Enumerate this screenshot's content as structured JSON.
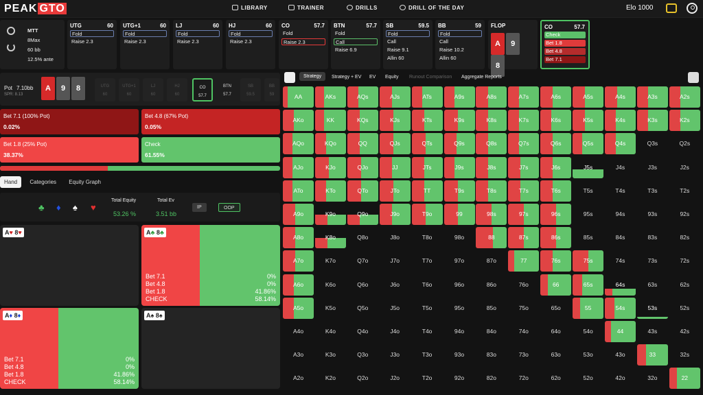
{
  "brand": {
    "logo_left": "PEAK",
    "logo_right": "GTO"
  },
  "nav": [
    {
      "label": "LIBRARY",
      "icon": "library-icon"
    },
    {
      "label": "TRAINER",
      "icon": "gamepad-icon"
    },
    {
      "label": "DRILLS",
      "icon": "drills-icon"
    },
    {
      "label": "DRILL OF THE DAY",
      "icon": "plus-circle-icon"
    }
  ],
  "elo": "Elo 1000",
  "game": {
    "type": "MTT",
    "players": "8Max",
    "stack": "60 bb",
    "ante": "12.5% ante"
  },
  "positions": [
    {
      "name": "UTG",
      "stack": "60",
      "actions": [
        "Fold",
        "Raise 2.3"
      ],
      "sel": 0
    },
    {
      "name": "UTG+1",
      "stack": "60",
      "actions": [
        "Fold",
        "Raise 2.3"
      ],
      "sel": 0
    },
    {
      "name": "LJ",
      "stack": "60",
      "actions": [
        "Fold",
        "Raise 2.3"
      ],
      "sel": 0
    },
    {
      "name": "HJ",
      "stack": "60",
      "actions": [
        "Fold",
        "Raise 2.3"
      ],
      "sel": 0
    },
    {
      "name": "CO",
      "stack": "57.7",
      "actions": [
        "Fold",
        "Raise 2.3"
      ],
      "sel": 1,
      "selcolor": "red"
    },
    {
      "name": "BTN",
      "stack": "57.7",
      "actions": [
        "Fold",
        "Call",
        "Raise 6.9"
      ],
      "sel": 1,
      "selcolor": "grn"
    },
    {
      "name": "SB",
      "stack": "59.5",
      "actions": [
        "Fold",
        "Call",
        "Raise 9.1",
        "Allin 60"
      ],
      "sel": 0
    },
    {
      "name": "BB",
      "stack": "59",
      "actions": [
        "Fold",
        "Call",
        "Raise 10.2",
        "Allin 60"
      ],
      "sel": 0
    }
  ],
  "flop": {
    "label": "FLOP",
    "cards": [
      "A",
      "9",
      "8"
    ]
  },
  "hero": {
    "name": "CO",
    "stack": "57.7",
    "actions": [
      "Check",
      "Bet 1.8",
      "Bet 4.8",
      "Bet 7.1"
    ]
  },
  "board": {
    "pot_label": "Pot",
    "pot": "7.10bb",
    "spr": "SPR: 8.13",
    "cards": [
      "A",
      "9",
      "8"
    ],
    "minis": [
      {
        "n": "UTG",
        "s": "60"
      },
      {
        "n": "UTG+1",
        "s": "60"
      },
      {
        "n": "LJ",
        "s": "60"
      },
      {
        "n": "HJ",
        "s": "60"
      },
      {
        "n": "CO",
        "s": "57.7"
      },
      {
        "n": "BTN",
        "s": "57.7"
      },
      {
        "n": "SB",
        "s": "59.5"
      },
      {
        "n": "BB",
        "s": "59"
      }
    ]
  },
  "action_boxes": [
    {
      "label": "Bet 7.1 (100% Pot)",
      "value": "0.02%",
      "color": "#8f1616"
    },
    {
      "label": "Bet 4.8 (67% Pot)",
      "value": "0.05%",
      "color": "#c42424"
    },
    {
      "label": "Bet 1.8 (25% Pot)",
      "value": "38.37%",
      "color": "#f04545"
    },
    {
      "label": "Check",
      "value": "61.55%",
      "color": "#62c46c"
    }
  ],
  "freq_split": 0.3844,
  "tabs": [
    "Hand",
    "Categories",
    "Equity Graph"
  ],
  "equity": {
    "total_equity_label": "Total Equity",
    "total_equity": "53.26 %",
    "total_ev_label": "Total Ev",
    "total_ev": "3.51 bb",
    "ip": "IP",
    "oop": "OOP"
  },
  "combos": [
    {
      "rank1": "A",
      "suit1": "♥",
      "rank2": "8",
      "suit2": "♥",
      "color": "rd",
      "red": 0,
      "grn": 0,
      "lines": []
    },
    {
      "rank1": "A",
      "suit1": "♣",
      "rank2": "8",
      "suit2": "♣",
      "color": "gr",
      "red": 0.42,
      "grn": 0.58,
      "lines": [
        [
          "Bet 7.1",
          "0%"
        ],
        [
          "Bet 4.8",
          "0%"
        ],
        [
          "Bet 1.8",
          "41.86%"
        ],
        [
          "CHECK",
          "58.14%"
        ]
      ]
    },
    {
      "rank1": "A",
      "suit1": "♦",
      "rank2": "8",
      "suit2": "♦",
      "color": "bl",
      "red": 0.42,
      "grn": 0.58,
      "lines": [
        [
          "Bet 7.1",
          "0%"
        ],
        [
          "Bet 4.8",
          "0%"
        ],
        [
          "Bet 1.8",
          "41.86%"
        ],
        [
          "CHECK",
          "58.14%"
        ]
      ]
    },
    {
      "rank1": "A",
      "suit1": "♠",
      "rank2": "8",
      "suit2": "♠",
      "color": "bk",
      "red": 0,
      "grn": 0,
      "lines": []
    }
  ],
  "strategy_tabs": [
    "Strategy",
    "Strategy + EV",
    "EV",
    "Equity",
    "Runout Comparison",
    "Aggregate Reports"
  ],
  "ranks": [
    "A",
    "K",
    "Q",
    "J",
    "T",
    "9",
    "8",
    "7",
    "6",
    "5",
    "4",
    "3",
    "2"
  ],
  "range_bet_fraction": [
    [
      0.15,
      0.3,
      0.35,
      0.4,
      0.35,
      0.35,
      0.4,
      0.35,
      0.4,
      0.4,
      0.4,
      0.35,
      0.35
    ],
    [
      0.35,
      0.3,
      0.4,
      0.45,
      0.4,
      0.45,
      0.4,
      0.35,
      0.35,
      0.4,
      0.35,
      0.35,
      0.35
    ],
    [
      0.3,
      0.35,
      0.4,
      0.45,
      0.45,
      0.4,
      0.4,
      0.35,
      0.4,
      0.3,
      0.35,
      0,
      0
    ],
    [
      0.3,
      0.45,
      0.45,
      0.4,
      0.4,
      0.35,
      0.4,
      0.4,
      0.4,
      0,
      0,
      0,
      0
    ],
    [
      0.3,
      0.35,
      0.45,
      0.45,
      0.4,
      0.45,
      0.4,
      0.4,
      0.4,
      0,
      0,
      0,
      0
    ],
    [
      0.4,
      0.4,
      0.4,
      0.4,
      0.45,
      0.45,
      0.5,
      0.5,
      0.5,
      0,
      0,
      0,
      0
    ],
    [
      0.4,
      0.4,
      0,
      0,
      0,
      0,
      0.55,
      0.5,
      0.5,
      0,
      0,
      0,
      0
    ],
    [
      0.4,
      0,
      0,
      0,
      0,
      0,
      0,
      0.2,
      0.4,
      0.5,
      0,
      0,
      0
    ],
    [
      0.35,
      0,
      0,
      0,
      0,
      0,
      0,
      0,
      0.25,
      0.3,
      0.25,
      0,
      0
    ],
    [
      0.35,
      0,
      0,
      0,
      0,
      0,
      0,
      0,
      0,
      0.25,
      0.3,
      0,
      0
    ],
    [
      0,
      0,
      0,
      0,
      0,
      0,
      0,
      0,
      0,
      0,
      0.2,
      0,
      0
    ],
    [
      0,
      0,
      0,
      0,
      0,
      0,
      0,
      0,
      0,
      0,
      0,
      0.3,
      0
    ],
    [
      0,
      0,
      0,
      0,
      0,
      0,
      0,
      0,
      0,
      0,
      0,
      0,
      0.25
    ]
  ],
  "range_fill": [
    [
      1,
      1,
      1,
      1,
      1,
      1,
      1,
      1,
      1,
      1,
      1,
      1,
      1
    ],
    [
      1,
      1,
      1,
      1,
      1,
      1,
      1,
      1,
      1,
      1,
      1,
      1,
      1
    ],
    [
      1,
      1,
      1,
      1,
      1,
      1,
      1,
      1,
      1,
      1,
      1,
      0,
      0
    ],
    [
      1,
      1,
      1,
      1,
      1,
      1,
      1,
      1,
      1,
      0.4,
      0,
      0,
      0
    ],
    [
      1,
      1,
      1,
      1,
      1,
      1,
      1,
      1,
      1,
      0,
      0,
      0,
      0
    ],
    [
      1,
      0.5,
      0.5,
      1,
      1,
      1,
      1,
      1,
      1,
      0,
      0,
      0,
      0
    ],
    [
      1,
      0.5,
      0,
      0,
      0,
      0,
      1,
      1,
      1,
      0,
      0,
      0,
      0
    ],
    [
      1,
      0,
      0,
      0,
      0,
      0,
      0,
      1,
      1,
      1,
      0,
      0,
      0
    ],
    [
      1,
      0,
      0,
      0,
      0,
      0,
      0,
      0,
      1,
      1,
      0.3,
      0,
      0
    ],
    [
      1,
      0,
      0,
      0,
      0,
      0,
      0,
      0,
      0,
      1,
      1,
      0.1,
      0
    ],
    [
      0,
      0,
      0,
      0,
      0,
      0,
      0,
      0,
      0,
      0,
      1,
      0,
      0
    ],
    [
      0,
      0,
      0,
      0,
      0,
      0,
      0,
      0,
      0,
      0,
      0,
      1,
      0
    ],
    [
      0,
      0,
      0,
      0,
      0,
      0,
      0,
      0,
      0,
      0,
      0,
      0,
      1
    ]
  ]
}
